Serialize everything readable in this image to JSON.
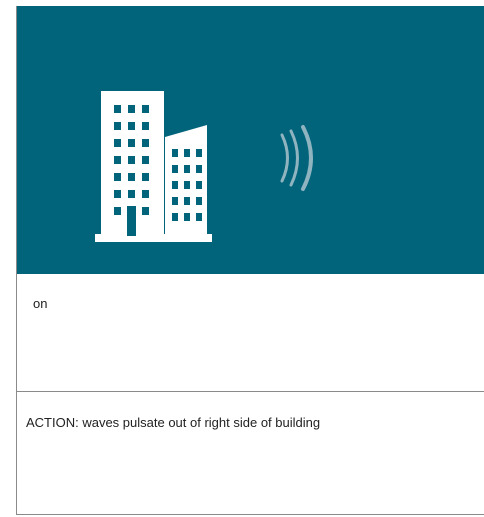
{
  "colors": {
    "hero_background": "#02647b",
    "building": "#ffffff",
    "waves": "#8fb4c0",
    "border": "#8a8a8a"
  },
  "illustration": {
    "building_icon": "office-building-icon",
    "waves_icon": "signal-waves-icon"
  },
  "panels": {
    "state_label": "on",
    "action_text": "ACTION: waves pulsate out of right side of building"
  }
}
